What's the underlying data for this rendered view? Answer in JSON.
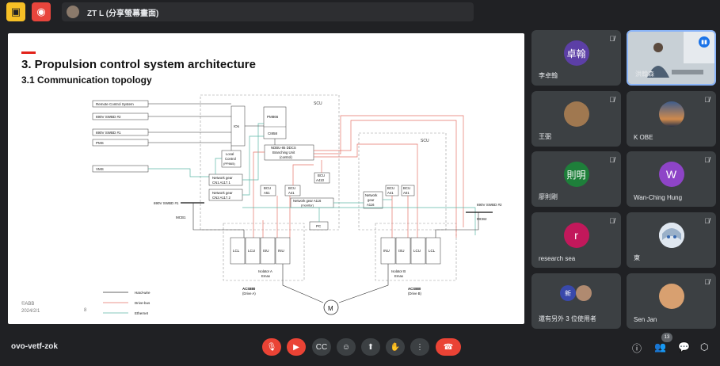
{
  "topbar": {
    "presenter_label": "ZT L (分享螢幕畫面)"
  },
  "slide": {
    "title": "3. Propulsion control system architecture",
    "subtitle": "3.1 Communication topology",
    "footer_brand": "©ABB",
    "footer_date": "2024/2/1",
    "footer_page": "8",
    "diagram": {
      "left_inputs": [
        "Remote Control System",
        "690V SWBD #2",
        "690V SWBD #1",
        "PMS",
        "VMS"
      ],
      "scu_label": "SCU",
      "ios": "IOs",
      "pm866": "PM866",
      "ci858": "CI858",
      "ndbu_l1": "NDBU-85 DDCS",
      "ndbu_l2": "Branching Unit",
      "ndbu_l3": "(control)",
      "local_l1": "Local",
      "local_l2": "Control",
      "local_l3": "(PP865)",
      "ng1_l1": "Network gear",
      "ng1_l2": "CN1 A117.1",
      "ng2_l1": "Network gear",
      "ng2_l2": "CN2 A117.2",
      "bcu_a51_l1": "BCU",
      "bcu_a51_l2": "A51",
      "bcu_a41_l1": "BCU",
      "bcu_a41_l2": "A41",
      "bcu_a410_l1": "BCU",
      "bcu_a410_l2": "A410",
      "ngm": "Network gear A116",
      "ngm_sub": "(monitor)",
      "pc": "PC",
      "swbd_left": "690V SWBD #1",
      "swbd_right": "690V SWBD #2",
      "mcb1": "MCB1",
      "mcb2": "MCB2",
      "drive_a_cells": [
        "LCL",
        "LCU",
        "ISU",
        "INU"
      ],
      "drive_b_cells": [
        "INU",
        "ISU",
        "LCU",
        "LCL"
      ],
      "isolator_a_l1": "Isolator A",
      "isolator_a_l2": "Emax",
      "isolator_b_l1": "Isolator B",
      "isolator_b_l2": "Emax",
      "acs_a_l1": "ACS880",
      "acs_a_l2": "(Drive A)",
      "acs_b_l1": "ACS880",
      "acs_b_l2": "(Drive B)",
      "motor": "M",
      "scu2_label": "SCU",
      "ng_r_l1": "Network",
      "ng_r_l2": "gear",
      "ng_r_l3": "A116",
      "bcu_ra41_l1": "BCU",
      "bcu_ra41_l2": "A41",
      "bcu_ra01_l1": "BCU",
      "bcu_ra01_l2": "A01",
      "legend": [
        "Hard-wire",
        "Drive-bus",
        "Ethernet"
      ],
      "colors": {
        "hardwire": "#333333",
        "drivebus": "#e57368",
        "ethernet": "#5fb8a8"
      }
    }
  },
  "participants": [
    {
      "name": "李卓翰",
      "avatar_text": "卓翰",
      "avatar_color": "#5c3fa6",
      "muted": true
    },
    {
      "name": "洪翰森",
      "avatar_text": "",
      "avatar_color": "",
      "muted": false,
      "speaking": true,
      "video": true
    },
    {
      "name": "王弼",
      "avatar_text": "",
      "avatar_color": "#a07850",
      "muted": true
    },
    {
      "name": "K OBE",
      "avatar_text": "",
      "avatar_color": "#d08a4c",
      "muted": true
    },
    {
      "name": "廖則剛",
      "avatar_text": "則明",
      "avatar_color": "#1e7f3a",
      "muted": true
    },
    {
      "name": "Wan-Ching Hung",
      "avatar_text": "W",
      "avatar_color": "#8e44c7",
      "muted": true
    },
    {
      "name": "research sea",
      "avatar_text": "r",
      "avatar_color": "#c2185b",
      "muted": true
    },
    {
      "name": "東",
      "avatar_text": "",
      "avatar_color": "#9ab0c8",
      "muted": true
    },
    {
      "name": "還有另外 3 位使用者",
      "avatar_text": "新",
      "avatar_color": "#3949ab",
      "muted": false
    },
    {
      "name": "Sen Jan",
      "avatar_text": "",
      "avatar_color": "#d8a070",
      "muted": true
    }
  ],
  "bottombar": {
    "meeting_code": "ovo-vetf-zok",
    "participant_count": "13"
  }
}
